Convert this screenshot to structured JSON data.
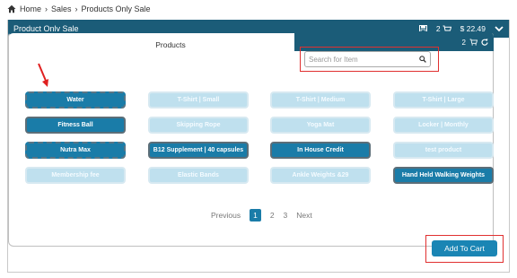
{
  "breadcrumb": {
    "items": [
      "Home",
      "Sales",
      "Products Only Sale"
    ]
  },
  "titlebar": {
    "title": "Product Only Sale",
    "cart_count": "2",
    "total": "$ 22.49"
  },
  "inner": {
    "tab_label": "Products",
    "cart_count": "2"
  },
  "search": {
    "placeholder": "Search for Item"
  },
  "products": [
    {
      "label": "Water",
      "state": "active-dashed"
    },
    {
      "label": "T-Shirt | Small",
      "state": "inactive"
    },
    {
      "label": "T-Shirt | Medium",
      "state": "inactive"
    },
    {
      "label": "T-Shirt | Large",
      "state": "inactive"
    },
    {
      "label": "Fitness Ball",
      "state": "active"
    },
    {
      "label": "Skipping Rope",
      "state": "inactive"
    },
    {
      "label": "Yoga Mat",
      "state": "inactive"
    },
    {
      "label": "Locker | Monthly",
      "state": "inactive"
    },
    {
      "label": "Nutra Max",
      "state": "active-dashed"
    },
    {
      "label": "B12 Supplement | 40 capsules",
      "state": "active"
    },
    {
      "label": "In House Credit",
      "state": "active"
    },
    {
      "label": "test product",
      "state": "inactive"
    },
    {
      "label": "Membership fee",
      "state": "inactive"
    },
    {
      "label": "Elastic Bands",
      "state": "inactive"
    },
    {
      "label": "Ankle Weights &29",
      "state": "inactive"
    },
    {
      "label": "Hand Held Walking Weights",
      "state": "active"
    }
  ],
  "pagination": {
    "previous": "Previous",
    "pages": [
      "1",
      "2",
      "3"
    ],
    "current": "1",
    "next": "Next"
  },
  "actions": {
    "add_to_cart": "Add To Cart"
  },
  "colors": {
    "header": "#1b5c78",
    "active_button": "#1a7ca8",
    "inactive_button": "#bfe0ee",
    "highlight": "#e03030"
  }
}
